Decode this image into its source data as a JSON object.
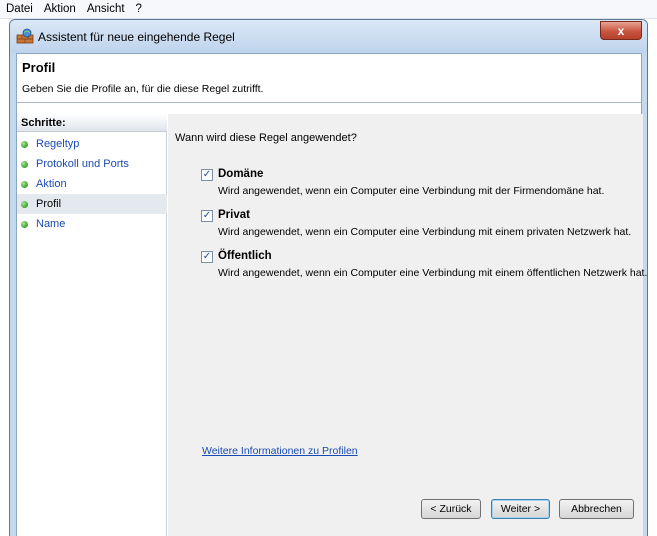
{
  "menubar": {
    "items": [
      "Datei",
      "Aktion",
      "Ansicht",
      "?"
    ]
  },
  "window": {
    "title": "Assistent für neue eingehende Regel",
    "close_label": "x"
  },
  "header": {
    "title": "Profil",
    "subtitle": "Geben Sie die Profile an, für die diese Regel zutrifft."
  },
  "sidebar": {
    "heading": "Schritte:",
    "steps": [
      {
        "label": "Regeltyp",
        "active": false
      },
      {
        "label": "Protokoll und Ports",
        "active": false
      },
      {
        "label": "Aktion",
        "active": false
      },
      {
        "label": "Profil",
        "active": true
      },
      {
        "label": "Name",
        "active": false
      }
    ]
  },
  "content": {
    "question": "Wann wird diese Regel angewendet?",
    "options": [
      {
        "label": "Domäne",
        "checked": true,
        "description": "Wird angewendet, wenn ein Computer eine Verbindung mit der Firmendomäne hat."
      },
      {
        "label": "Privat",
        "checked": true,
        "description": "Wird angewendet, wenn ein Computer eine Verbindung mit einem privaten Netzwerk hat."
      },
      {
        "label": "Öffentlich",
        "checked": true,
        "description": "Wird angewendet, wenn ein Computer eine Verbindung mit einem öffentlichen Netzwerk hat."
      }
    ],
    "more_info_link": "Weitere Informationen zu Profilen"
  },
  "buttons": {
    "back": "< Zurück",
    "next": "Weiter >",
    "cancel": "Abbrechen"
  },
  "checkmark": "✓",
  "colors": {
    "link": "#1a4bb3",
    "close_button": "#c8553f",
    "step_bullet": "#3aa02b"
  }
}
